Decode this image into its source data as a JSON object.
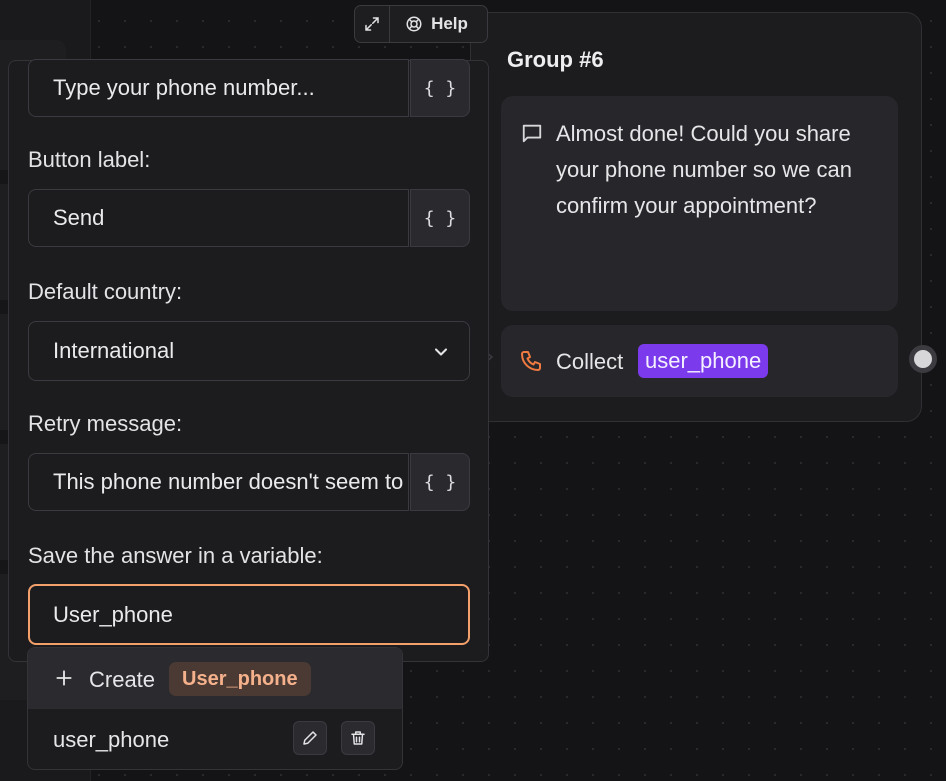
{
  "toolbar": {
    "help_label": "Help",
    "expand_icon": "expand-icon",
    "help_icon": "lifebuoy-icon"
  },
  "group": {
    "title": "Group #6",
    "message": "Almost done! Could you share your phone number so we can confirm your appointment?",
    "collect_label": "Collect",
    "collect_variable": "user_phone"
  },
  "settings": {
    "placeholder_value": "Type your phone number...",
    "button_label_title": "Button label:",
    "button_label_value": "Send",
    "default_country_title": "Default country:",
    "default_country_value": "International",
    "retry_title": "Retry message:",
    "retry_value": "This phone number doesn't seem to be valid.",
    "save_title": "Save the answer in a variable:",
    "save_value": "User_phone",
    "variable_button": "{ }"
  },
  "dropdown": {
    "create_label": "Create",
    "create_value": "User_phone",
    "items": [
      {
        "label": "user_phone"
      }
    ]
  },
  "colors": {
    "accent_purple": "#7c3aed",
    "focus_orange": "#f3a06b",
    "phone_orange": "#f07a3f"
  }
}
